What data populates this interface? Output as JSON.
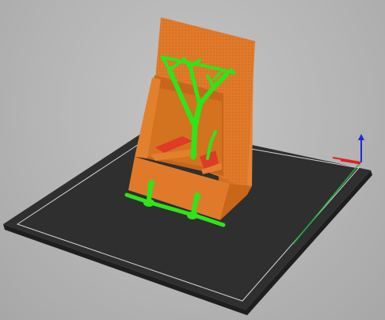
{
  "viewport": {
    "background_color": "#b5b5b5"
  },
  "bed": {
    "surface_color": "#2f2f2f",
    "edge_color": "#1e1e1e",
    "outline_color": "#d6d6d6"
  },
  "axes": {
    "x_color": "#e02020",
    "y_color": "#20b040",
    "z_color": "#1f2bd6"
  },
  "model": {
    "body_color": "#e07a2a",
    "shadow_color": "#b85a16",
    "overhang_color": "#e03a28",
    "support_color": "#2ee51a",
    "icon": "phone-stand-model"
  }
}
